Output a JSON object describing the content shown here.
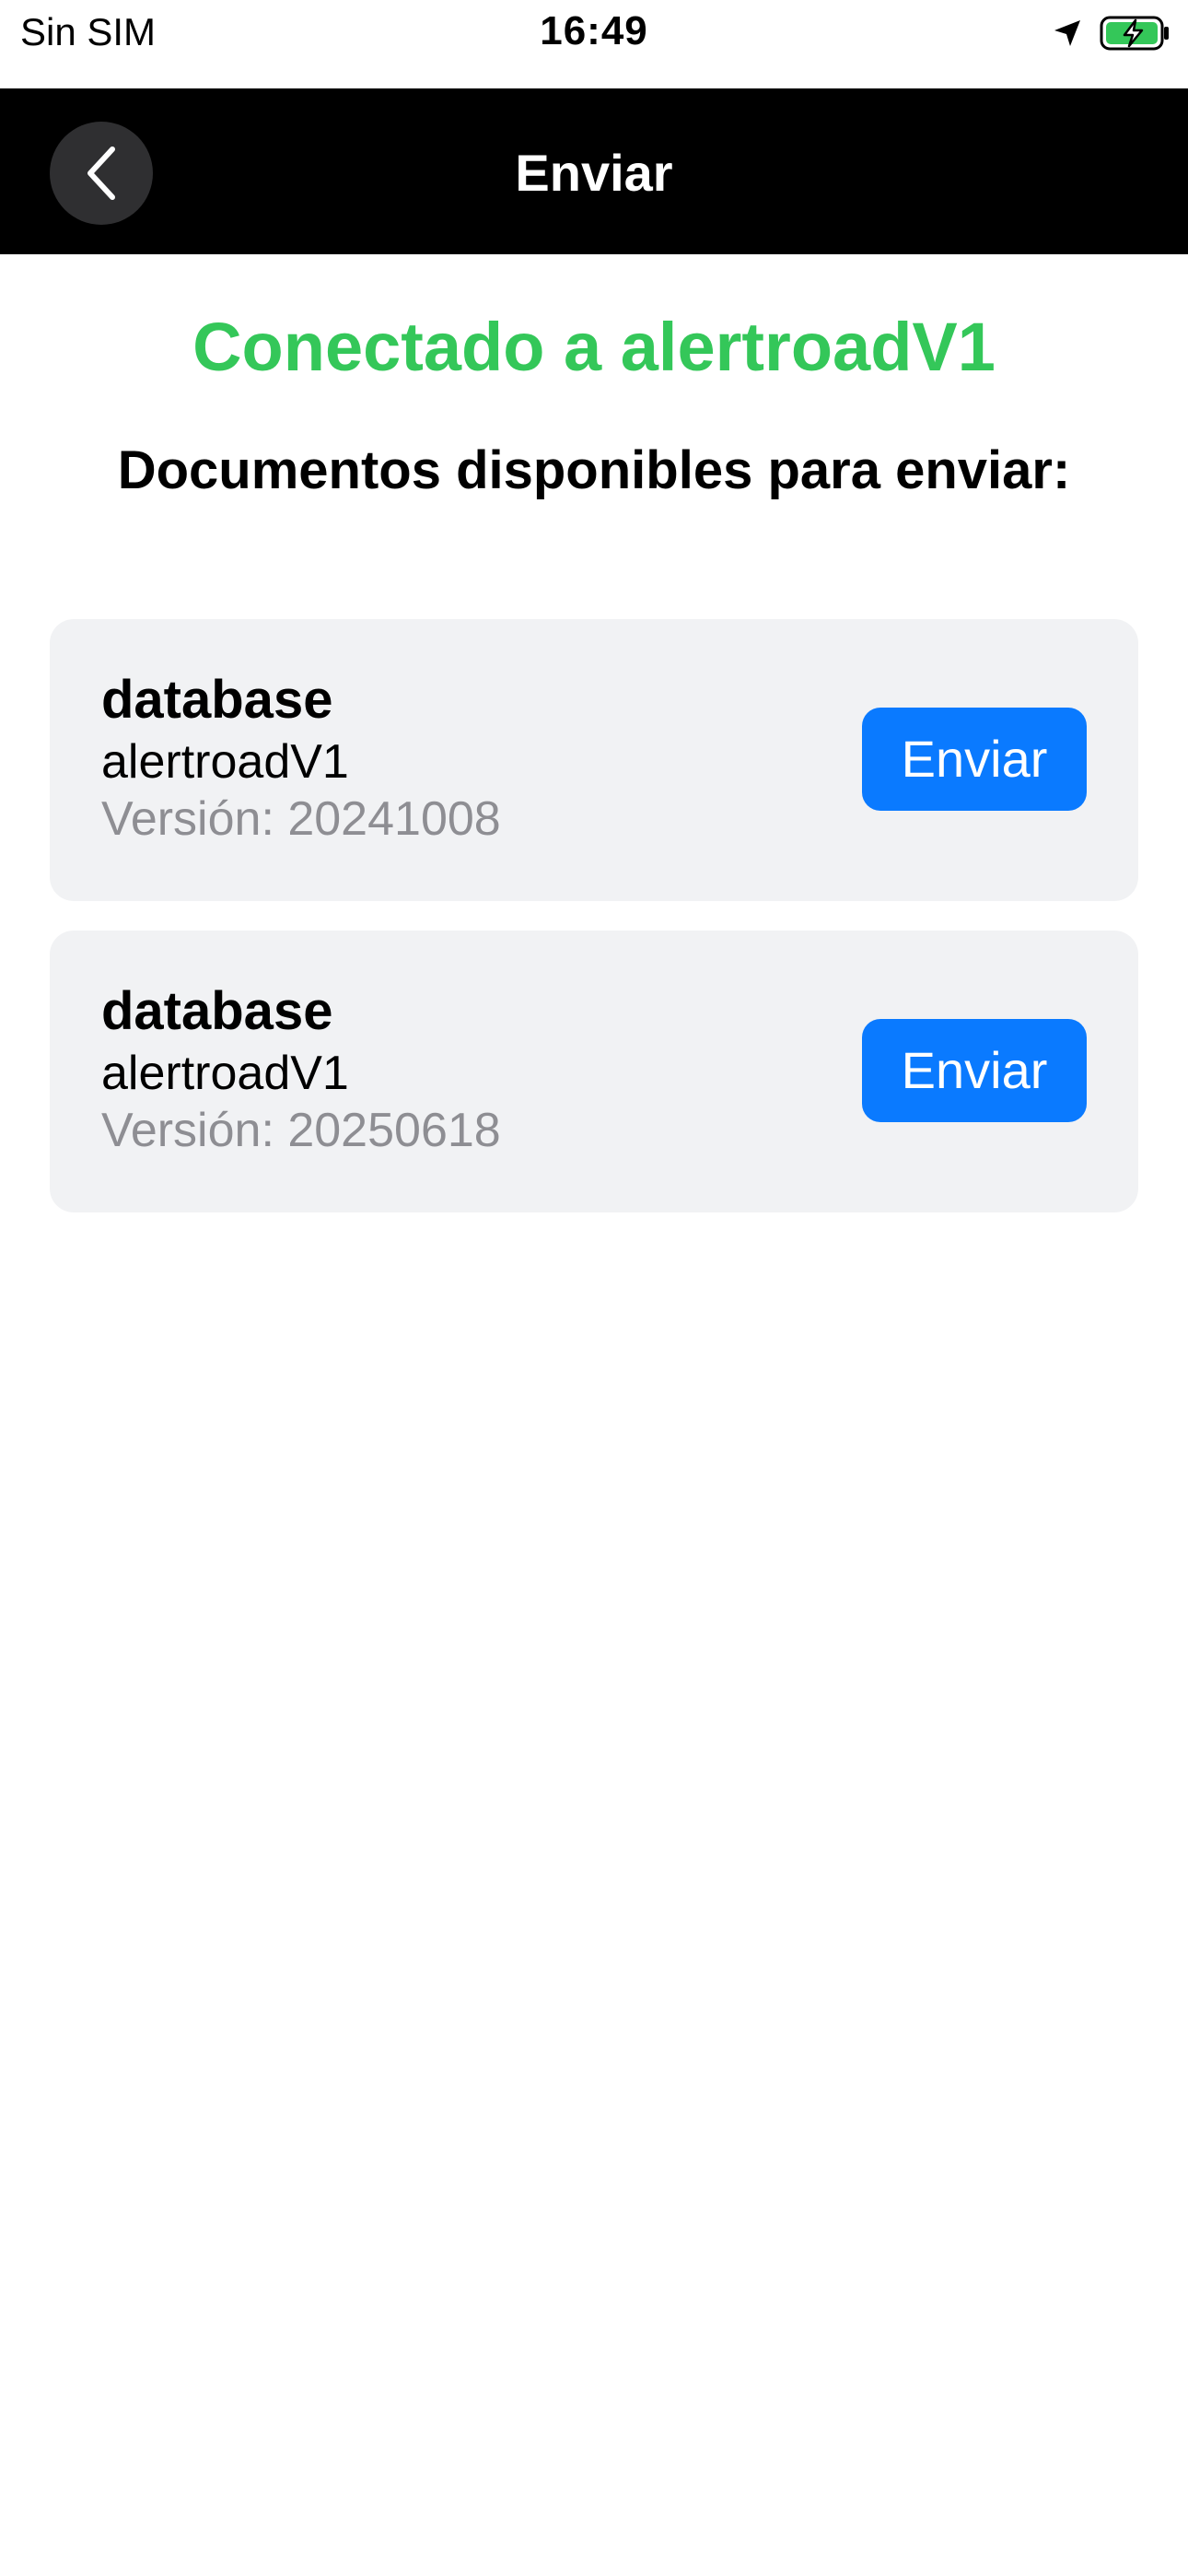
{
  "status_bar": {
    "carrier": "Sin SIM",
    "time": "16:49",
    "location_icon": "location-arrow-icon",
    "battery_icon": "battery-charging-icon",
    "battery_color": "#34c759"
  },
  "nav": {
    "title": "Enviar",
    "back_icon": "chevron-left-icon"
  },
  "connection": {
    "status_text": "Conectado a alertroadV1",
    "status_color": "#34c759"
  },
  "documents": {
    "heading": "Documentos disponibles para enviar:",
    "items": [
      {
        "name": "database",
        "device": "alertroadV1",
        "version": "Versión: 20241008",
        "button_label": "Enviar"
      },
      {
        "name": "database",
        "device": "alertroadV1",
        "version": "Versión: 20250618",
        "button_label": "Enviar"
      }
    ]
  },
  "colors": {
    "accent": "#0a7aff",
    "card_background": "#f1f2f4",
    "secondary_text": "#8e8e93",
    "nav_background": "#000000"
  }
}
